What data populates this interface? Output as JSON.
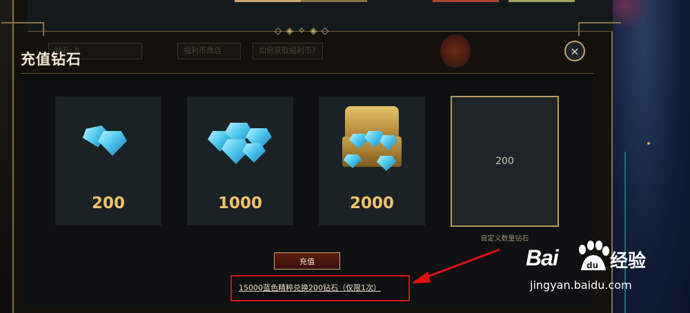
{
  "dialog": {
    "title": "充值钻石",
    "close_symbol": "×"
  },
  "background": {
    "top_left_label": "钻石: 0",
    "button_1": "福利币商店",
    "button_2": "如何获取福利币?"
  },
  "packages": [
    {
      "amount": "200",
      "icon": "small-diamonds-icon"
    },
    {
      "amount": "1000",
      "icon": "diamond-pile-icon"
    },
    {
      "amount": "2000",
      "icon": "treasure-chest-icon"
    }
  ],
  "custom": {
    "value": "200",
    "label": "自定义数量钻石"
  },
  "recharge_label": "充值",
  "exchange_link": "15000蓝色精粹兑换200钻石（仅限1次）",
  "watermark": {
    "brand": "Bai",
    "paw_text": "du",
    "suffix": "经验",
    "url": "jingyan.baidu.com"
  },
  "colors": {
    "gold": "#c8aa6e",
    "amount_gold": "#f0c36a",
    "highlight_red": "#e01010"
  }
}
